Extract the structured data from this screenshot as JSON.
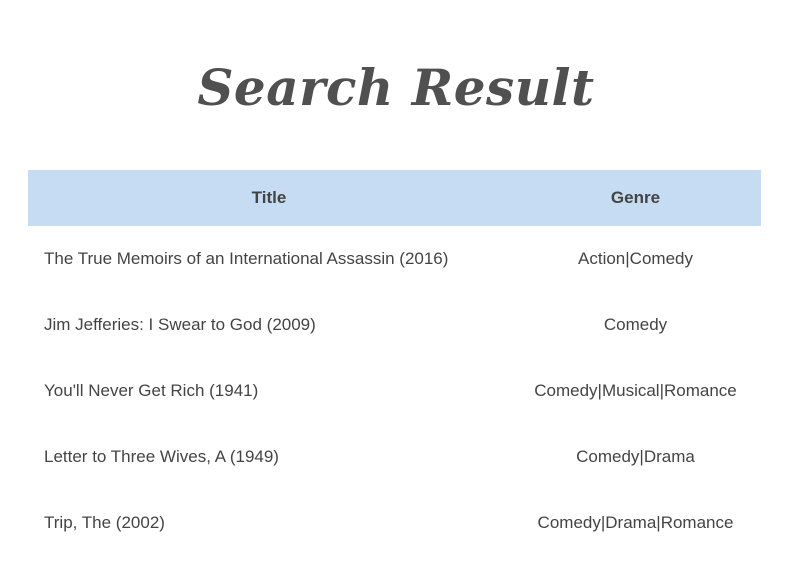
{
  "page": {
    "title": "Search Result"
  },
  "table": {
    "headers": {
      "title": "Title",
      "genre": "Genre"
    },
    "rows": [
      {
        "title": "The True Memoirs of an International Assassin (2016)",
        "genre": "Action|Comedy"
      },
      {
        "title": "Jim Jefferies: I Swear to God (2009)",
        "genre": "Comedy"
      },
      {
        "title": "You'll Never Get Rich (1941)",
        "genre": "Comedy|Musical|Romance"
      },
      {
        "title": "Letter to Three Wives, A (1949)",
        "genre": "Comedy|Drama"
      },
      {
        "title": "Trip, The (2002)",
        "genre": "Comedy|Drama|Romance"
      }
    ]
  },
  "colors": {
    "header_background": "#c6dcf2",
    "text": "#444444",
    "title_text": "#505050"
  }
}
